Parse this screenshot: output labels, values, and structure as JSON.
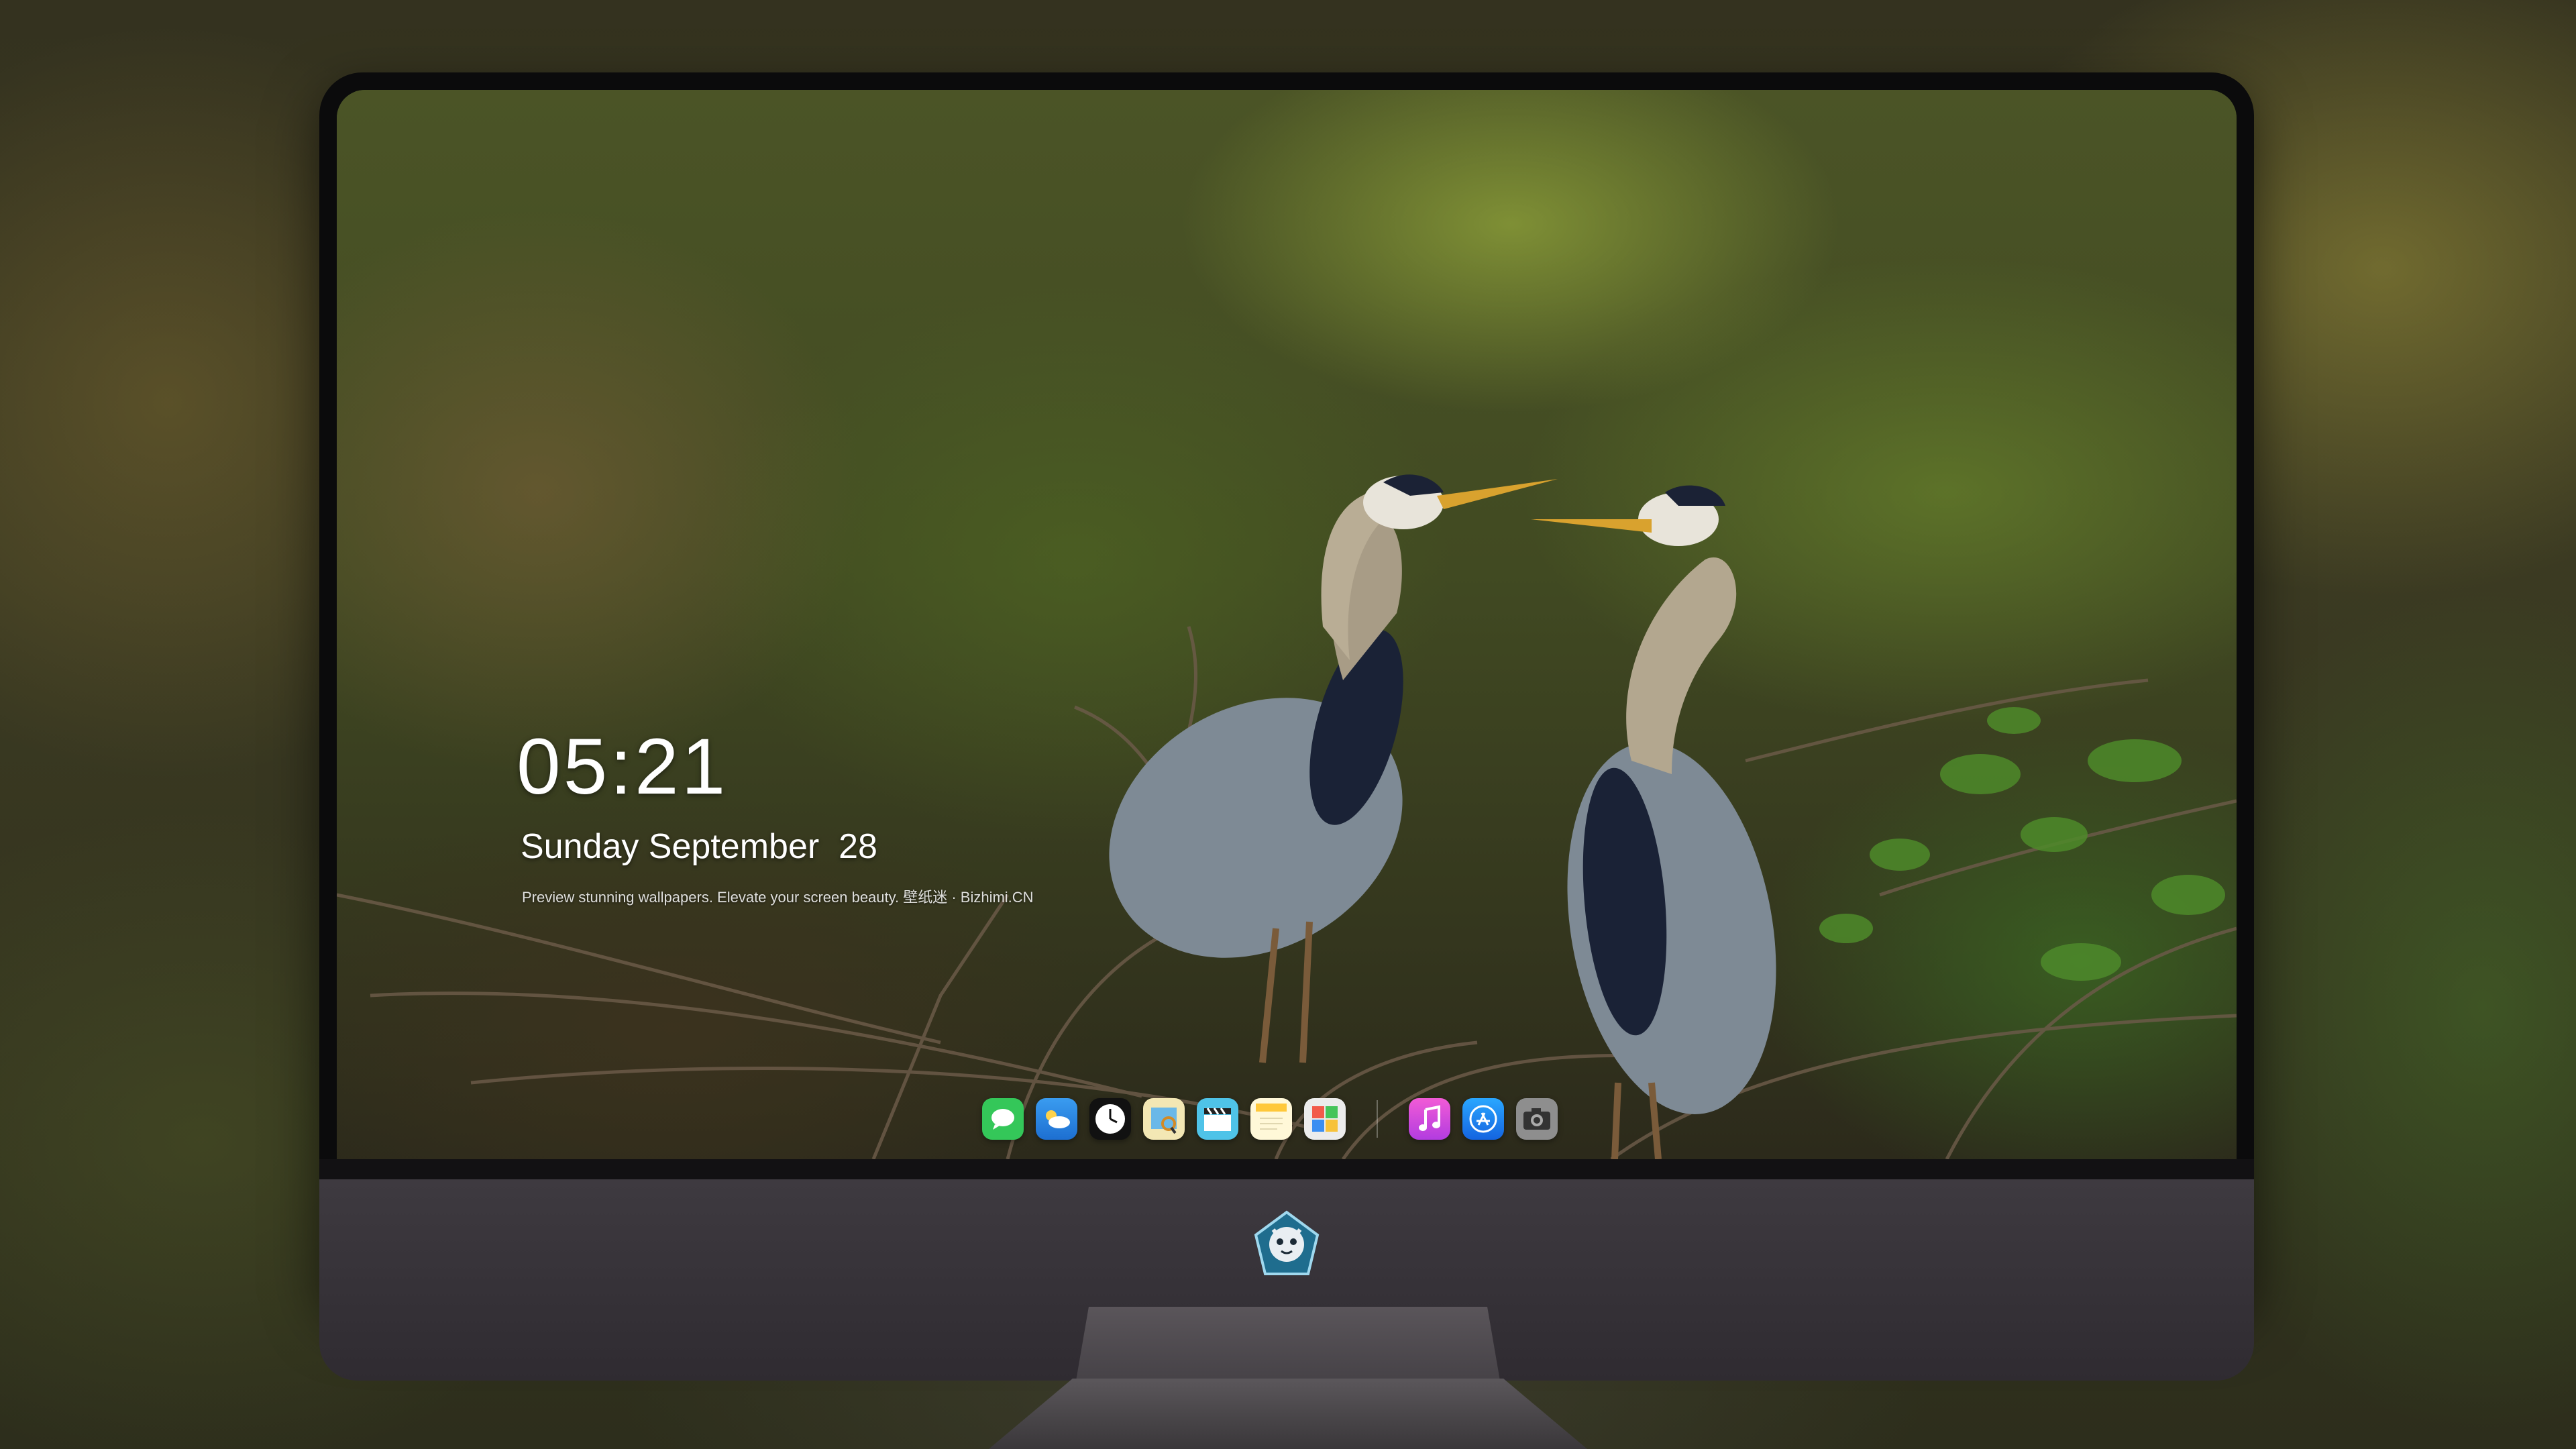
{
  "lock_screen": {
    "time": "05:21",
    "date": "Sunday September  28",
    "caption": "Preview stunning wallpapers. Elevate your screen beauty. 壁纸迷 · Bizhimi.CN"
  },
  "dock": {
    "apps": [
      {
        "name": "Messages",
        "icon": "messages-icon",
        "color": "#34c759"
      },
      {
        "name": "Weather",
        "icon": "weather-icon",
        "color": "#2f8de4"
      },
      {
        "name": "Clock",
        "icon": "clock-icon",
        "color": "#111111"
      },
      {
        "name": "Preview",
        "icon": "preview-icon",
        "color": "#e9c64a"
      },
      {
        "name": "Clips",
        "icon": "clapperboard-icon",
        "color": "#4fc3e8"
      },
      {
        "name": "Notes",
        "icon": "notes-icon",
        "color": "#ffd54a"
      },
      {
        "name": "Photo Booth",
        "icon": "photo-grid-icon",
        "color": "#e8e8e8"
      },
      {
        "name": "Music",
        "icon": "music-icon",
        "color": "#d64be0"
      },
      {
        "name": "App Store",
        "icon": "app-store-icon",
        "color": "#1e88f5"
      },
      {
        "name": "Camera",
        "icon": "camera-icon",
        "color": "#8a8a8a"
      }
    ]
  },
  "colors": {
    "monitor_bezel": "#0b0b0c",
    "monitor_chin": "#3e3a40",
    "stand": "#5a555a"
  }
}
